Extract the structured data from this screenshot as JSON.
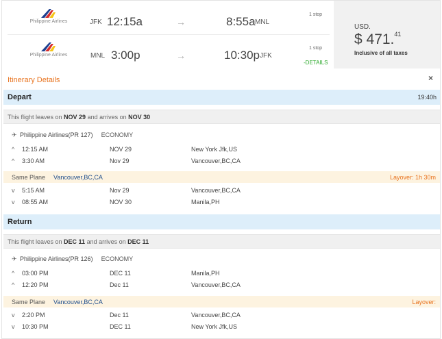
{
  "summary": {
    "rows": [
      {
        "airline": "Philippine Airlines",
        "from_code": "JFK",
        "from_time": "12:15a",
        "to_time": "8:55a",
        "to_code": "MNL",
        "stops": "1 stop"
      },
      {
        "airline": "Philippine Airlines",
        "from_code": "MNL",
        "from_time": "3:00p",
        "to_time": "10:30p",
        "to_code": "JFK",
        "stops": "1 stop"
      }
    ],
    "arrow": "→",
    "details_link": "-DETAILS",
    "currency": "USD.",
    "price_main": "$ 471.",
    "price_cents": "41",
    "inclusive": "Inclusive of all taxes"
  },
  "itinerary": {
    "title": "Itinerary Details",
    "close": "×",
    "depart": {
      "label": "Depart",
      "duration": "19:40h",
      "leaves_prefix": "This flight leaves on ",
      "leaves_date": "NOV 29",
      "arrives_mid": " and arrives on ",
      "arrives_date": "NOV 30",
      "airline": "Philippine Airlines(PR 127)",
      "cabin": "ECONOMY",
      "segments": [
        {
          "chev": "^",
          "time": "12:15 AM",
          "date": "NOV 29",
          "city": "New York Jfk,US"
        },
        {
          "chev": "^",
          "time": "3:30 AM",
          "date": "Nov 29",
          "city": "Vancouver,BC,CA"
        },
        {
          "chev": "v",
          "time": "5:15 AM",
          "date": "Nov 29",
          "city": "Vancouver,BC,CA"
        },
        {
          "chev": "v",
          "time": "08:55 AM",
          "date": "NOV 30",
          "city": "Manila,PH"
        }
      ],
      "same_plane": "Same Plane",
      "layover_place": "Vancouver,BC,CA",
      "layover": "Layover: 1h 30m"
    },
    "return": {
      "label": "Return",
      "leaves_prefix": "This flight leaves on ",
      "leaves_date": "DEC 11",
      "arrives_mid": " and arrives on ",
      "arrives_date": "DEC 11",
      "airline": "Philippine Airlines(PR 126)",
      "cabin": "ECONOMY",
      "segments": [
        {
          "chev": "^",
          "time": "03:00 PM",
          "date": "DEC 11",
          "city": "Manila,PH"
        },
        {
          "chev": "^",
          "time": "12:20 PM",
          "date": "Dec 11",
          "city": "Vancouver,BC,CA"
        },
        {
          "chev": "v",
          "time": "2:20 PM",
          "date": "Dec 11",
          "city": "Vancouver,BC,CA"
        },
        {
          "chev": "v",
          "time": "10:30 PM",
          "date": "DEC 11",
          "city": "New York Jfk,US"
        }
      ],
      "same_plane": "Same Plane",
      "layover_place": "Vancouver,BC,CA",
      "layover": "Layover:"
    }
  },
  "colors": {
    "accent": "#e8731e",
    "link": "#2aa82a",
    "section": "#ddeefa",
    "layover_bg": "#fdf3e0"
  }
}
